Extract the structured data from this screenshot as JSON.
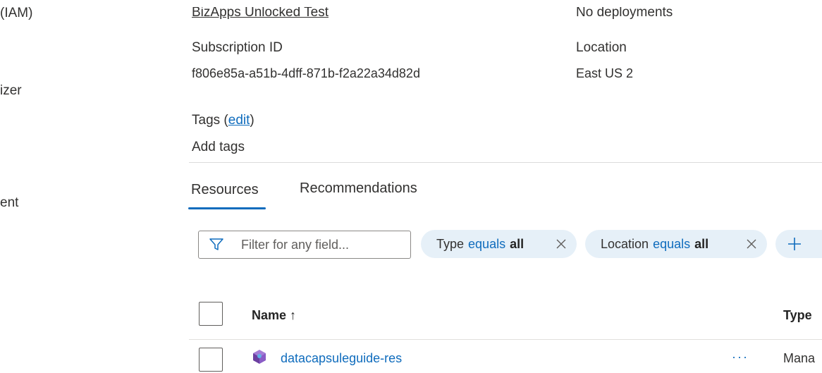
{
  "left_nav": {
    "items": [
      "(IAM)",
      "izer",
      "ent"
    ]
  },
  "essentials": {
    "subscription_name_link": "BizApps Unlocked Test",
    "deployments_link": "No deployments",
    "subscription_id_label": "Subscription ID",
    "subscription_id_value": "f806e85a-a51b-4dff-871b-f2a22a34d82d",
    "location_label": "Location",
    "location_value": "East US 2",
    "tags_label": "Tags (",
    "tags_edit_link": "edit",
    "tags_close_paren": ")",
    "add_tags_link": "Add tags"
  },
  "tabs": [
    {
      "label": "Resources",
      "selected": true
    },
    {
      "label": "Recommendations",
      "selected": false
    }
  ],
  "filter": {
    "placeholder": "Filter for any field...",
    "value": ""
  },
  "pills": [
    {
      "field": "Type",
      "op": "equals",
      "value": "all"
    },
    {
      "field": "Location",
      "op": "equals",
      "value": "all"
    }
  ],
  "table": {
    "columns": {
      "name": "Name ↑",
      "type": "Type"
    },
    "rows": [
      {
        "name": "datacapsuleguide-res",
        "type": "Mana",
        "more": "···"
      }
    ]
  },
  "colors": {
    "accent": "#0f6cbd",
    "pill_bg": "#e6f0f8"
  },
  "icons": [
    "filter-icon",
    "close-icon",
    "add-icon",
    "resource-group-icon"
  ]
}
